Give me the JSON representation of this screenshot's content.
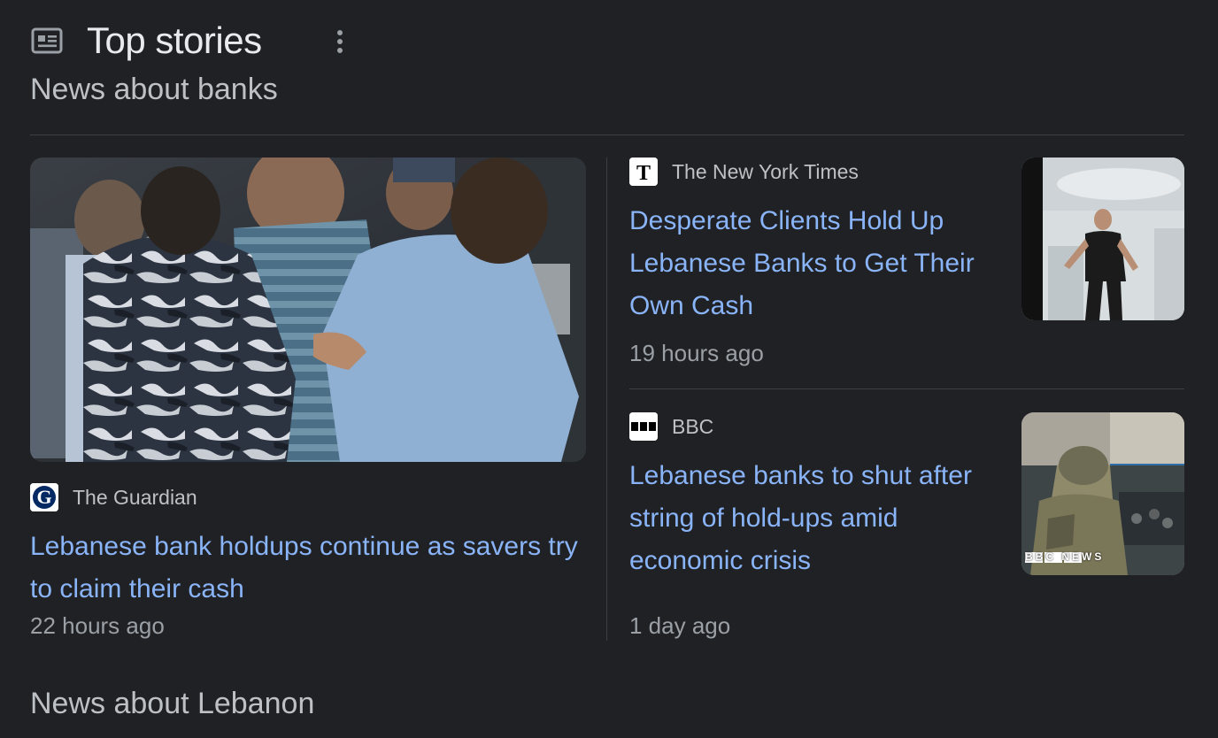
{
  "header": {
    "title": "Top stories",
    "icon": "newspaper-icon",
    "menu_icon": "more-vert-icon"
  },
  "sections": {
    "banks": "News about banks",
    "lebanon": "News about Lebanon"
  },
  "stories": {
    "main": {
      "source": "The Guardian",
      "headline": "Lebanese bank holdups continue as savers try to claim their cash",
      "time": "22 hours ago"
    },
    "nyt": {
      "source": "The New York Times",
      "headline": "Desperate Clients Hold Up Lebanese Banks to Get Their Own Cash",
      "time": "19 hours ago"
    },
    "bbc": {
      "source": "BBC",
      "headline": "Lebanese banks to shut after string of hold-ups amid economic crisis",
      "time": "1 day ago",
      "thumb_watermark": "BBC NEWS"
    }
  },
  "colors": {
    "background": "#202124",
    "link": "#8ab4f8",
    "muted": "#9aa0a6"
  }
}
